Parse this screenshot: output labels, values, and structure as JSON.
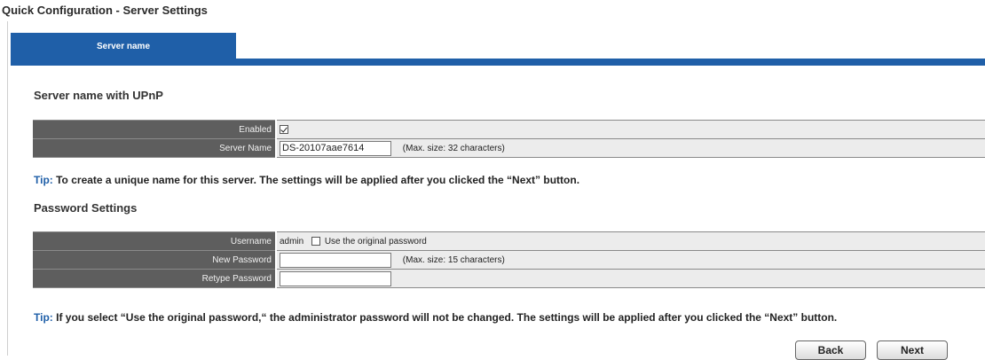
{
  "page": {
    "title": "Quick Configuration - Server Settings"
  },
  "tabs": [
    {
      "label": "Server name",
      "active": true
    }
  ],
  "colors": {
    "accent": "#1f5fa8",
    "label_bg": "#5e5e5e",
    "value_bg": "#ececec"
  },
  "upnp": {
    "section_title": "Server name with UPnP",
    "enabled_label": "Enabled",
    "enabled_checked": true,
    "server_name_label": "Server Name",
    "server_name_value": "DS-20107aae7614",
    "server_name_hint": "(Max. size: 32 characters)"
  },
  "tip1": {
    "label": "Tip:",
    "text": " To create a unique name for this server. The settings will be applied after you clicked the “Next” button."
  },
  "password": {
    "section_title": "Password Settings",
    "username_label": "Username",
    "username_value": "admin",
    "use_original_label": "Use the original password",
    "use_original_checked": false,
    "new_password_label": "New Password",
    "new_password_value": "",
    "new_password_hint": "(Max. size: 15 characters)",
    "retype_password_label": "Retype Password",
    "retype_password_value": ""
  },
  "tip2": {
    "label": "Tip:",
    "text": " If you select “Use the original password,“ the administrator password will not be changed. The settings will be applied after you clicked the “Next” button."
  },
  "buttons": {
    "back_label": "Back",
    "next_label": "Next"
  }
}
